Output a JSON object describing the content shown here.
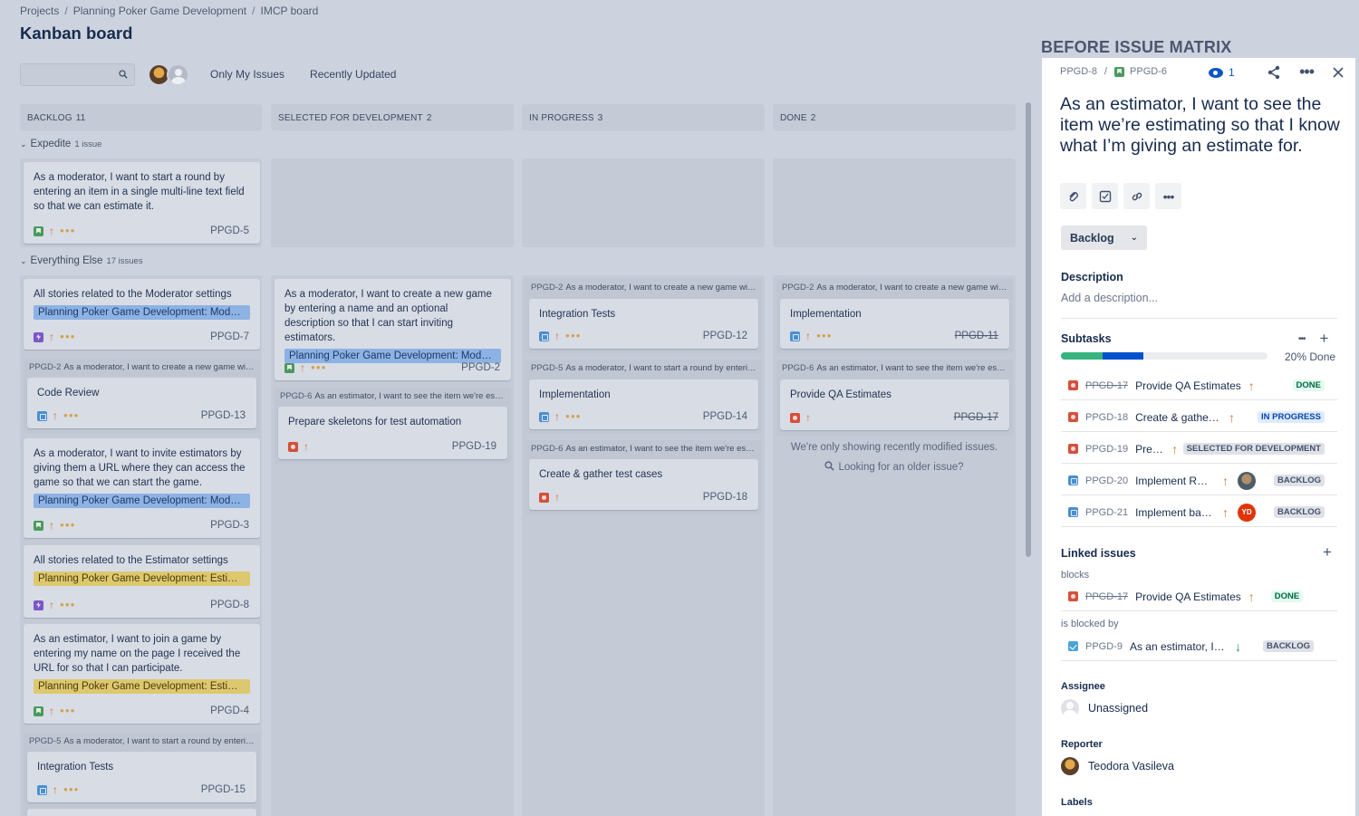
{
  "breadcrumb": [
    "Projects",
    "Planning Poker Game Development",
    "IMCP board"
  ],
  "page_title": "Kanban board",
  "toolbar": {
    "search_placeholder": "",
    "filters": [
      "Only My Issues",
      "Recently Updated"
    ]
  },
  "columns": [
    {
      "name": "BACKLOG",
      "count": "11"
    },
    {
      "name": "SELECTED FOR DEVELOPMENT",
      "count": "2"
    },
    {
      "name": "IN PROGRESS",
      "count": "3"
    },
    {
      "name": "DONE",
      "count": "2"
    }
  ],
  "swimlanes": [
    {
      "name": "Expedite",
      "count": "1 issue"
    },
    {
      "name": "Everything Else",
      "count": "17 issues"
    }
  ],
  "cards": {
    "c1": {
      "summary": "As a moderator, I want to start a round by entering an item in a single multi-line text field so that we can estimate it.",
      "key": "PPGD-5"
    },
    "c2": {
      "summary": "All stories related to the Moderator settings",
      "epic": "Planning Poker Game Development: Moderator",
      "key": "PPGD-7"
    },
    "c3": {
      "parent_key": "PPGD-2",
      "parent_text": "As a moderator, I want to create a new game with a name",
      "summary": "Code Review",
      "key": "PPGD-13"
    },
    "c4": {
      "summary": "As a moderator, I want to invite estimators by giving them a URL where they can access the game so that we can start the game.",
      "epic": "Planning Poker Game Development: Moderator",
      "key": "PPGD-3"
    },
    "c5": {
      "summary": "All stories related to the Estimator settings",
      "epic": "Planning Poker Game Development: Estimate",
      "key": "PPGD-8"
    },
    "c6": {
      "summary": "As an estimator, I want to join a game by entering my name on the page I received the URL for so that I can participate.",
      "epic": "Planning Poker Game Development: Estimate",
      "key": "PPGD-4"
    },
    "c7": {
      "parent_key": "PPGD-5",
      "parent_text": "As a moderator, I want to start a round by entering an item",
      "summary": "Integration Tests",
      "key": "PPGD-15"
    },
    "c8": {
      "summary": "As a moderator, I want to create a new game by entering a name and an optional description so that I can start inviting estimators.",
      "epic": "Planning Poker Game Development: Moderator",
      "key": "PPGD-2"
    },
    "c9": {
      "parent_key": "PPGD-6",
      "parent_text": "As an estimator, I want to see the item we're estimating",
      "summary": "Prepare skeletons for test automation",
      "key": "PPGD-19"
    },
    "c10": {
      "parent_key": "PPGD-2",
      "parent_text": "As a moderator, I want to create a new game with a name",
      "summary": "Integration Tests",
      "key": "PPGD-12"
    },
    "c11": {
      "parent_key": "PPGD-5",
      "parent_text": "As a moderator, I want to start a round by entering an item",
      "summary": "Implementation",
      "key": "PPGD-14"
    },
    "c12": {
      "parent_key": "PPGD-6",
      "parent_text": "As an estimator, I want to see the item we're estimating",
      "summary": "Create & gather test cases",
      "key": "PPGD-18"
    },
    "c13": {
      "parent_key": "PPGD-2",
      "parent_text": "As a moderator, I want to create a new game with a name",
      "summary": "Implementation",
      "key": "PPGD-11"
    },
    "c14": {
      "parent_key": "PPGD-6",
      "parent_text": "As an estimator, I want to see the item we're estimating",
      "summary": "Provide QA Estimates",
      "key": "PPGD-17"
    }
  },
  "recent_note": {
    "line1": "We're only showing recently modified issues.",
    "line2": "Looking for an older issue?"
  },
  "matrix_title": "BEFORE ISSUE MATRIX",
  "panel": {
    "parent_key": "PPGD-8",
    "issue_key": "PPGD-6",
    "watch_count": "1",
    "title": "As an estimator, I want to see the item we’re estimating so that I know what I’m giving an estimate for.",
    "status": "Backlog",
    "description_label": "Description",
    "description_placeholder": "Add a description...",
    "subtasks_label": "Subtasks",
    "progress": {
      "done_fraction": 0.2,
      "in_progress_fraction": 0.2,
      "text": "20% Done"
    },
    "subtasks": [
      {
        "key": "PPGD-17",
        "summary": "Provide QA Estimates",
        "status": "DONE"
      },
      {
        "key": "PPGD-18",
        "summary": "Create & gather test cases",
        "status": "IN PROGRESS"
      },
      {
        "key": "PPGD-19",
        "summary": "Prepare skeletons for test automation",
        "status": "SELECTED FOR DEVELOPMENT"
      },
      {
        "key": "PPGD-20",
        "summary": "Implement REST API",
        "status": "BACKLOG"
      },
      {
        "key": "PPGD-21",
        "summary": "Implement backend",
        "status": "BACKLOG",
        "avatar": "YD"
      }
    ],
    "linked_label": "Linked issues",
    "blocks_label": "blocks",
    "blocks": {
      "key": "PPGD-17",
      "summary": "Provide QA Estimates",
      "status": "DONE"
    },
    "blocked_by_label": "is blocked by",
    "blocked_by": {
      "key": "PPGD-9",
      "summary": "As an estimator, I want to",
      "status": "BACKLOG"
    },
    "assignee_label": "Assignee",
    "assignee": "Unassigned",
    "reporter_label": "Reporter",
    "reporter": "Teodora Vasileva",
    "labels_label": "Labels"
  },
  "colors": {
    "story": "#4a9a5e",
    "epic": "#7b57c8",
    "bug": "#d5503b",
    "subtask": "#4a8fd0",
    "priority_high": "#d9742f",
    "priority_low": "#2f8f4e"
  }
}
